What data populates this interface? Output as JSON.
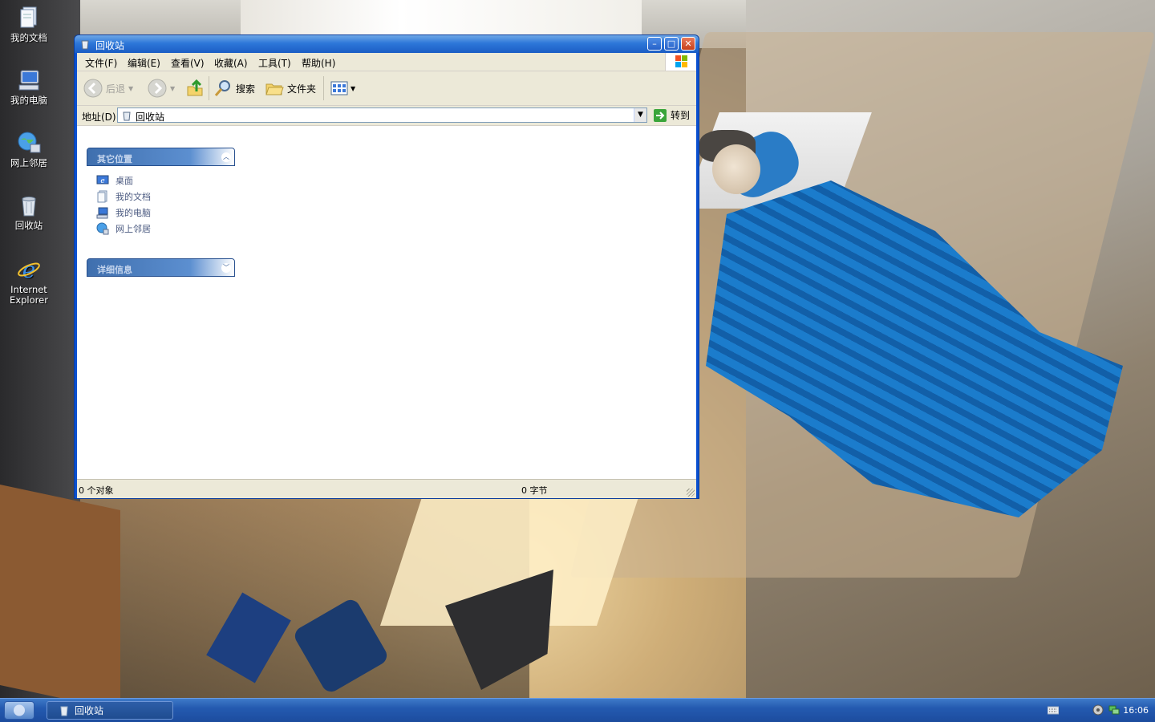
{
  "desktop": {
    "icons": [
      {
        "label": "我的文档"
      },
      {
        "label": "我的电脑"
      },
      {
        "label": "网上邻居"
      },
      {
        "label": "回收站"
      },
      {
        "label_line1": "Internet",
        "label_line2": "Explorer"
      }
    ]
  },
  "window": {
    "title": "回收站",
    "buttons": {
      "minimize": "–",
      "maximize": "□",
      "close": "✕"
    },
    "menu": [
      "文件(F)",
      "编辑(E)",
      "查看(V)",
      "收藏(A)",
      "工具(T)",
      "帮助(H)"
    ],
    "toolbar": {
      "back": "后退",
      "search": "搜索",
      "folders": "文件夹"
    },
    "address": {
      "label": "地址(D)",
      "value": "回收站",
      "go": "转到"
    },
    "panels": {
      "other_places": {
        "title": "其它位置",
        "links": [
          "桌面",
          "我的文档",
          "我的电脑",
          "网上邻居"
        ]
      },
      "details": {
        "title": "详细信息"
      }
    },
    "status": {
      "objects": "0 个对象",
      "size": "0 字节"
    }
  },
  "taskbar": {
    "task_label": "回收站",
    "clock": "16:06"
  },
  "colors": {
    "title_bar": "#2d77d9",
    "taskbar": "#245ab0",
    "chrome": "#ece9d8",
    "panel_header": "#3f6fae"
  }
}
